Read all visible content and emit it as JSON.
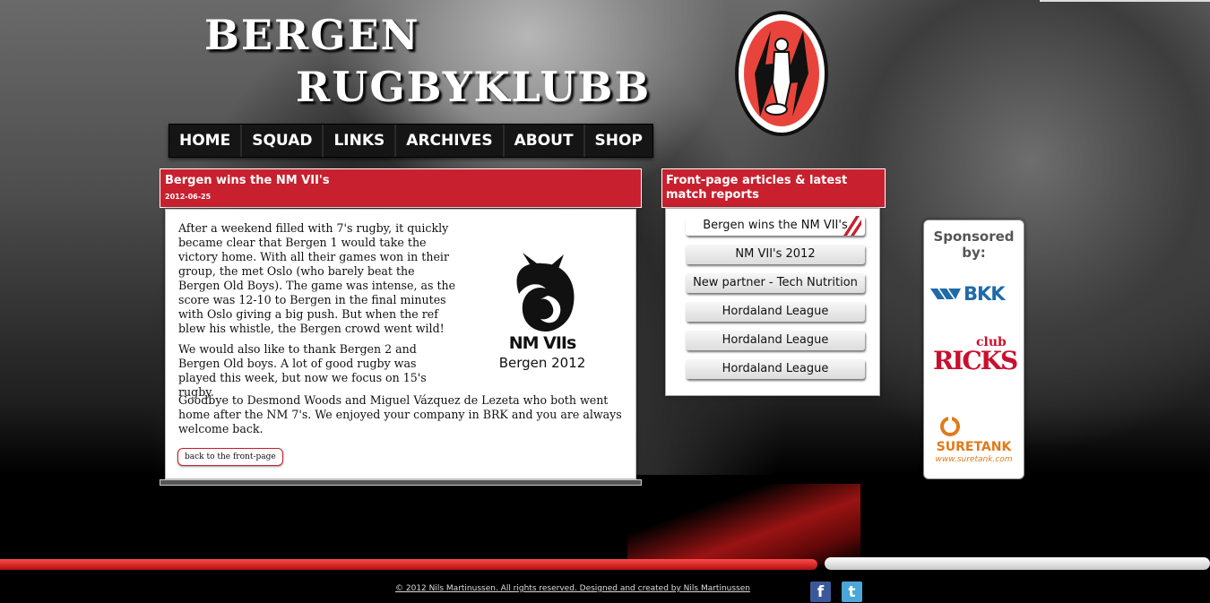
{
  "site": {
    "title_line1": "BERGEN",
    "title_line2": "RUGBYKLUBB"
  },
  "nav": {
    "items": [
      "HOME",
      "SQUAD",
      "LINKS",
      "ARCHIVES",
      "ABOUT",
      "SHOP"
    ]
  },
  "article": {
    "title": "Bergen wins the NM VII's",
    "date": "2012-06-25",
    "paragraphs": [
      "After a weekend filled with 7's rugby, it quickly became clear that Bergen 1 would take the victory home. With all their games won in their group, the met Oslo (who barely beat the Bergen Old Boys). The game was intense, as the score was 12-10 to Bergen in the final minutes with Oslo giving a big push. But when the ref blew his whistle, the Bergen crowd went wild!",
      "We would also like to thank Bergen 2 and Bergen Old boys. A lot of good rugby was played this week, but now we focus on 15's rugby.",
      "Goodbye to Desmond Woods and Miguel Vázquez de Lezeta who both went home after the NM 7's. We enjoyed your company in BRK and you are always welcome back."
    ],
    "back_label": "back to the front-page",
    "image_title": "NM VIIs",
    "image_subtitle": "Bergen 2012"
  },
  "side": {
    "title": "Front-page articles & latest match reports",
    "items": [
      "Bergen wins the NM VII's",
      "NM VII's 2012",
      "New partner - Tech Nutrition",
      "Hordaland League",
      "Hordaland League",
      "Hordaland League"
    ]
  },
  "sponsors": {
    "title": "Sponsored by:",
    "bkk": "BKK",
    "ricks": "RICKS",
    "ricks_club": "club",
    "suretank": "SURETANK",
    "suretank_url": "www.suretank.com"
  },
  "footer": {
    "copyright": "© 2012 Nils Martinussen. All rights reserved. Designed and created by Nils Martinussen",
    "facebook": "f",
    "twitter": "t"
  },
  "colors": {
    "accent": "#c8202e",
    "nav_bg": "#151515"
  }
}
